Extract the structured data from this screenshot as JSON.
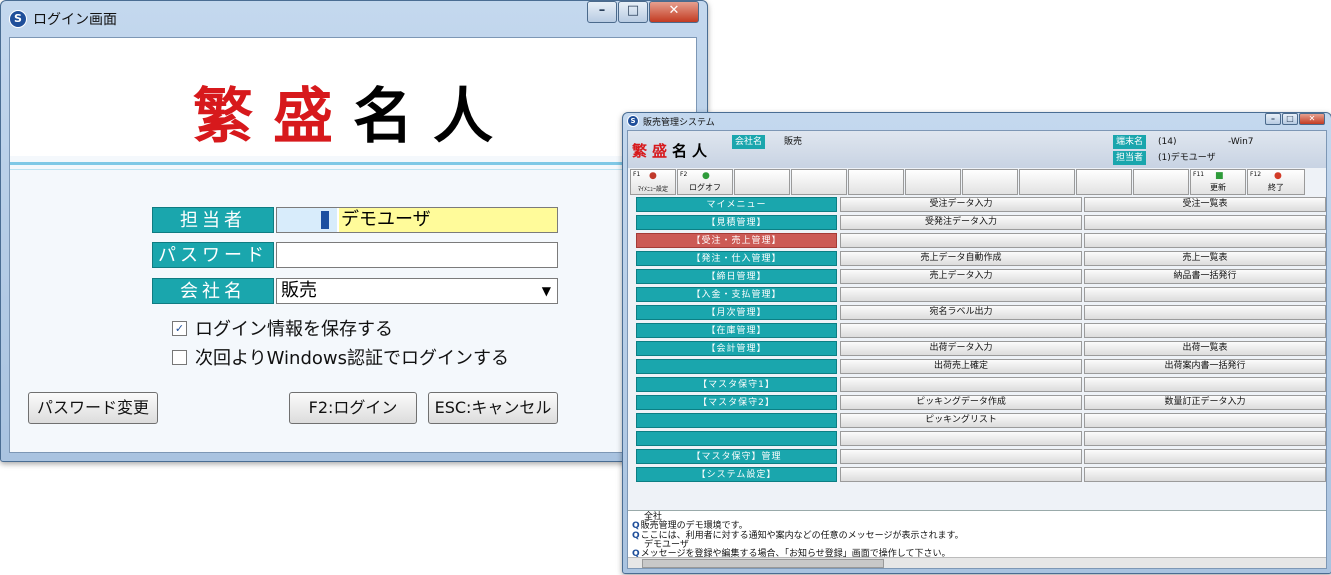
{
  "login": {
    "window_title": "ログイン画面",
    "logo": [
      "繁",
      "盛",
      "名",
      "人"
    ],
    "fields": {
      "user_label": "担当者",
      "user_code": "",
      "user_name": "デモユーザ",
      "password_label": "パスワード",
      "password_value": "",
      "company_label": "会社名",
      "company_value": "販売"
    },
    "checkboxes": [
      {
        "label": "ログイン情報を保存する",
        "checked": true
      },
      {
        "label": "次回よりWindows認証でログインする",
        "checked": false
      }
    ],
    "buttons": {
      "change_password": "パスワード変更",
      "login": "F2:ログイン",
      "cancel": "ESC:キャンセル"
    }
  },
  "main": {
    "window_title": "販売管理システム",
    "logo": [
      "繁",
      "盛",
      "名",
      "人"
    ],
    "company_label": "会社名",
    "company_value": "販売",
    "terminal_label": "端末名",
    "terminal_value": "(14)",
    "terminal_suffix": "-Win7",
    "user_label": "担当者",
    "user_value": "(1)デモユーザ",
    "toolbar": {
      "f1_key": "F1",
      "f1_label": "ﾏｲﾒﾆｭｰ設定",
      "f2_key": "F2",
      "f2_label": "ログオフ",
      "f11_key": "F11",
      "f11_label": "更新",
      "f12_key": "F12",
      "f12_label": "終了"
    },
    "menu_rows": [
      {
        "left": "マイメニュー",
        "mid": "受注データ入力",
        "right": "受注一覧表"
      },
      {
        "left": "【見積管理】",
        "mid": "受発注データ入力",
        "right": ""
      },
      {
        "left": "【受注・売上管理】",
        "mid": "",
        "right": "",
        "active": true
      },
      {
        "left": "【発注・仕入管理】",
        "mid": "売上データ自動作成",
        "right": "売上一覧表"
      },
      {
        "left": "【締日管理】",
        "mid": "売上データ入力",
        "right": "納品書一括発行"
      },
      {
        "left": "【入金・支払管理】",
        "mid": "",
        "right": ""
      },
      {
        "left": "【月次管理】",
        "mid": "宛名ラベル出力",
        "right": ""
      },
      {
        "left": "【在庫管理】",
        "mid": "",
        "right": ""
      },
      {
        "left": "【会計管理】",
        "mid": "出荷データ入力",
        "right": "出荷一覧表"
      },
      {
        "left": "",
        "mid": "出荷売上確定",
        "right": "出荷案内書一括発行"
      },
      {
        "left": "【マスタ保守1】",
        "mid": "",
        "right": ""
      },
      {
        "left": "【マスタ保守2】",
        "mid": "ピッキングデータ作成",
        "right": "数量訂正データ入力"
      },
      {
        "left": "",
        "mid": "ピッキングリスト",
        "right": ""
      },
      {
        "left": "",
        "mid": "",
        "right": ""
      },
      {
        "left": "【マスタ保守】管理",
        "mid": "",
        "right": ""
      },
      {
        "left": "【システム設定】",
        "mid": "",
        "right": ""
      }
    ],
    "messages": [
      {
        "text": "全社",
        "icon": false
      },
      {
        "text": "販売管理のデモ環境です。",
        "icon": true
      },
      {
        "text": "ここには、利用者に対する通知や案内などの任意のメッセージが表示されます。",
        "icon": true
      },
      {
        "text": "デモユーザ",
        "icon": false
      },
      {
        "text": "メッセージを登録や編集する場合、「お知らせ登録」画面で操作して下さい。",
        "icon": true
      }
    ]
  }
}
